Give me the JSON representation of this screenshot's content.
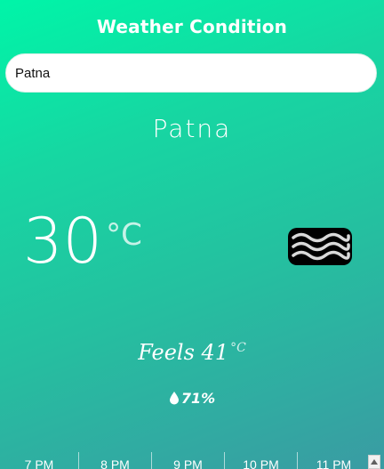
{
  "app": {
    "title": "Weather Condition"
  },
  "search": {
    "value": "Patna",
    "placeholder": ""
  },
  "weather": {
    "city": "Patna",
    "temperature": "30",
    "temp_unit": "°C",
    "condition_icon": "haze-waves-icon",
    "feels_label": "Feels 41",
    "feels_unit": "°C",
    "humidity": "71%",
    "humidity_icon": "water-drop-icon"
  },
  "hourly": [
    {
      "time": "7 PM"
    },
    {
      "time": "8 PM"
    },
    {
      "time": "9 PM"
    },
    {
      "time": "10 PM"
    },
    {
      "time": "11 PM"
    }
  ],
  "colors": {
    "gradient_start": "#00f5a8",
    "gradient_end": "#3a9ba3",
    "text": "#ffffff"
  }
}
